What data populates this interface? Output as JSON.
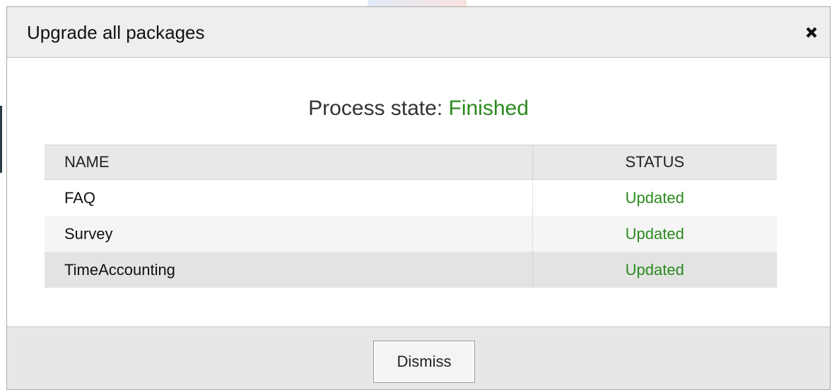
{
  "dialog": {
    "title": "Upgrade all packages",
    "close_icon": "close-icon"
  },
  "process": {
    "label": "Process state:",
    "value": "Finished",
    "value_color": "#2b8a1e"
  },
  "table": {
    "headers": {
      "name": "NAME",
      "status": "STATUS"
    },
    "rows": [
      {
        "name": "FAQ",
        "status": "Updated"
      },
      {
        "name": "Survey",
        "status": "Updated"
      },
      {
        "name": "TimeAccounting",
        "status": "Updated"
      }
    ]
  },
  "footer": {
    "dismiss_label": "Dismiss"
  }
}
